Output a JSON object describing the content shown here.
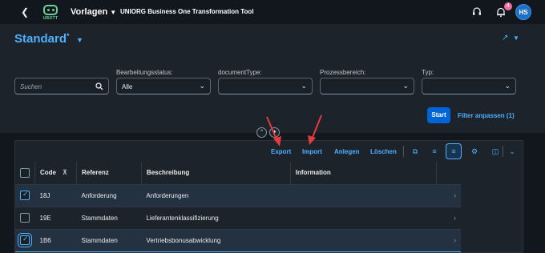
{
  "shell": {
    "back_icon": "chevron-left",
    "logo_text": "UBOTT",
    "menu_label": "Vorlagen",
    "app_title": "UNIORG Business One Transformation Tool",
    "notification_count": "4",
    "avatar_initials": "HS"
  },
  "header": {
    "variant_title": "Standard",
    "variant_modified": "*"
  },
  "filters": {
    "search": {
      "placeholder": "Suchen",
      "value": ""
    },
    "items": [
      {
        "label": "Bearbeitungsstatus:",
        "value": "Alle"
      },
      {
        "label": "documentType:",
        "value": ""
      },
      {
        "label": "Prozessbereich:",
        "value": ""
      },
      {
        "label": "Typ:",
        "value": ""
      }
    ],
    "start_label": "Start",
    "adapt_label": "Filter anpassen (1)"
  },
  "toolbar": {
    "export_label": "Export",
    "import_label": "Import",
    "create_label": "Anlegen",
    "delete_label": "Löschen"
  },
  "table": {
    "columns": [
      "Code",
      "Referenz",
      "Beschreibung",
      "Information"
    ],
    "rows": [
      {
        "selected": true,
        "code": "18J",
        "ref": "Anforderung",
        "desc": "Anforderungen"
      },
      {
        "selected": false,
        "code": "19E",
        "ref": "Stammdaten",
        "desc": "Lieferantenklassifizierung"
      },
      {
        "selected": true,
        "code": "1B6",
        "ref": "Stammdaten",
        "desc": "Vertriebsbonusabwicklung"
      }
    ]
  },
  "colors": {
    "accent": "#4db1ff",
    "primary_button": "#0064d9",
    "background": "#12171d",
    "annotation_arrow": "#e03c3c"
  }
}
